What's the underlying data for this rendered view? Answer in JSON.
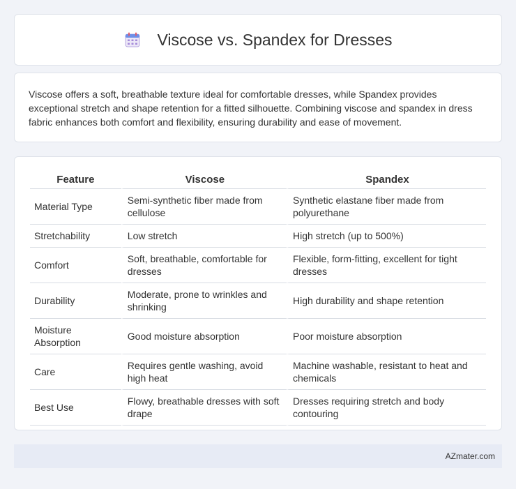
{
  "header": {
    "icon": "calendar-icon",
    "title": "Viscose vs. Spandex for Dresses"
  },
  "intro": {
    "text": "Viscose offers a soft, breathable texture ideal for comfortable dresses, while Spandex provides exceptional stretch and shape retention for a fitted silhouette. Combining viscose and spandex in dress fabric enhances both comfort and flexibility, ensuring durability and ease of movement."
  },
  "table": {
    "headers": [
      "Feature",
      "Viscose",
      "Spandex"
    ],
    "rows": [
      [
        "Material Type",
        "Semi-synthetic fiber made from cellulose",
        "Synthetic elastane fiber made from polyurethane"
      ],
      [
        "Stretchability",
        "Low stretch",
        "High stretch (up to 500%)"
      ],
      [
        "Comfort",
        "Soft, breathable, comfortable for dresses",
        "Flexible, form-fitting, excellent for tight dresses"
      ],
      [
        "Durability",
        "Moderate, prone to wrinkles and shrinking",
        "High durability and shape retention"
      ],
      [
        "Moisture Absorption",
        "Good moisture absorption",
        "Poor moisture absorption"
      ],
      [
        "Care",
        "Requires gentle washing, avoid high heat",
        "Machine washable, resistant to heat and chemicals"
      ],
      [
        "Best Use",
        "Flowy, breathable dresses with soft drape",
        "Dresses requiring stretch and body contouring"
      ]
    ]
  },
  "footer": {
    "brand": "AZmater.com"
  }
}
